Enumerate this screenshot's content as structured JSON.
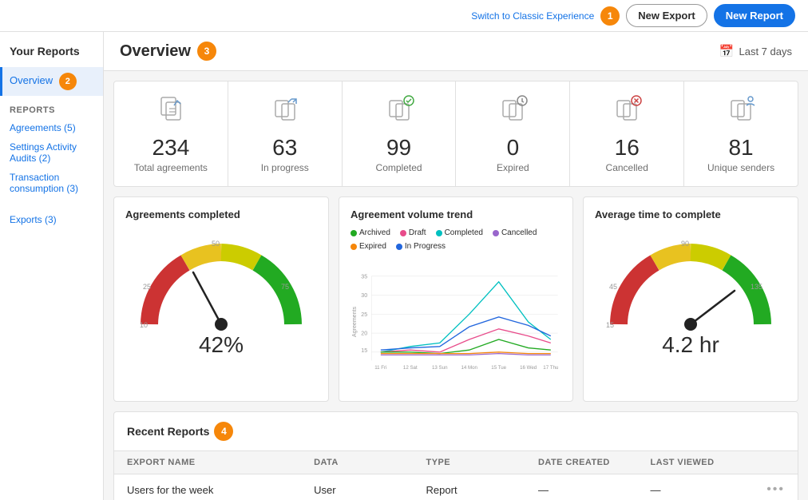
{
  "topbar": {
    "switch_label": "Switch to Classic Experience",
    "badge1": "1",
    "btn_new_export": "New Export",
    "btn_new_report": "New Report"
  },
  "sidebar": {
    "header": "Your Reports",
    "overview_label": "Overview",
    "badge2": "2",
    "reports_section": "REPORTS",
    "agreements_label": "Agreements (5)",
    "settings_label": "Settings Activity Audits (2)",
    "transaction_label": "Transaction consumption (3)",
    "exports_label": "Exports (3)"
  },
  "content": {
    "title": "Overview",
    "badge3": "3",
    "date_filter": "Last 7 days"
  },
  "stats": [
    {
      "icon": "📄",
      "number": "234",
      "label": "Total agreements"
    },
    {
      "icon": "⇄",
      "number": "63",
      "label": "In progress"
    },
    {
      "icon": "✓",
      "number": "99",
      "label": "Completed"
    },
    {
      "icon": "🕐",
      "number": "0",
      "label": "Expired"
    },
    {
      "icon": "✗",
      "number": "16",
      "label": "Cancelled"
    },
    {
      "icon": "👤",
      "number": "81",
      "label": "Unique senders"
    }
  ],
  "charts": {
    "agreements_completed": {
      "title": "Agreements completed",
      "percent": "42%"
    },
    "volume_trend": {
      "title": "Agreement volume trend",
      "legend": [
        {
          "label": "Archived",
          "color": "#22aa22"
        },
        {
          "label": "Draft",
          "color": "#e84c8b"
        },
        {
          "label": "Completed",
          "color": "#00c0c0"
        },
        {
          "label": "Cancelled",
          "color": "#9966cc"
        },
        {
          "label": "Expired",
          "color": "#F6870A"
        },
        {
          "label": "In Progress",
          "color": "#2266dd"
        }
      ],
      "xLabels": [
        "11 Fri",
        "12 Sat",
        "13 Sun",
        "14 Mon",
        "15 Tue",
        "16 Wed",
        "17 Thu"
      ]
    },
    "avg_time": {
      "title": "Average time to complete",
      "value": "4.2 hr"
    }
  },
  "recent_reports": {
    "title": "Recent Reports",
    "badge4": "4",
    "columns": [
      "EXPORT NAME",
      "DATA",
      "TYPE",
      "DATE CREATED",
      "LAST VIEWED",
      ""
    ],
    "rows": [
      {
        "export_name": "Users for the week",
        "data": "User",
        "type": "Report",
        "date_created": "—",
        "last_viewed": "—"
      }
    ]
  }
}
